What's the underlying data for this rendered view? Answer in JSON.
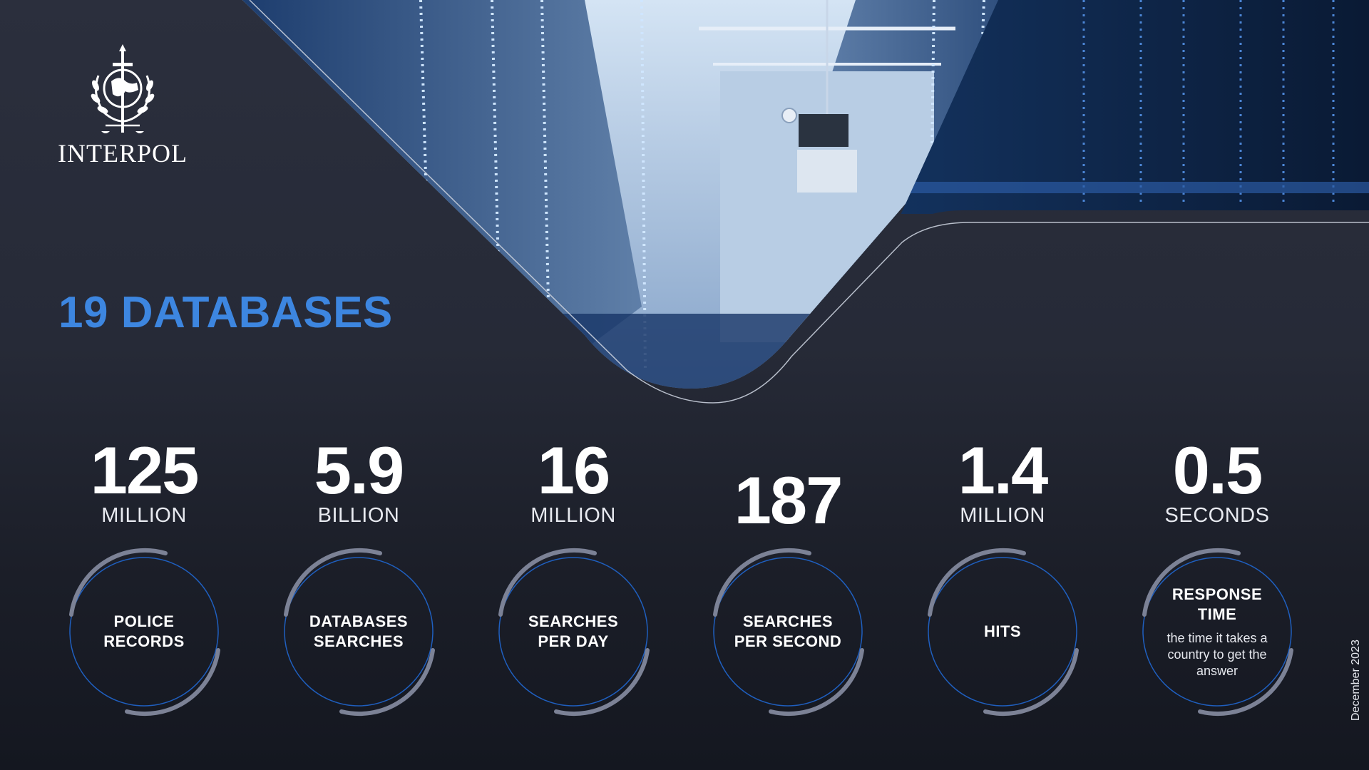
{
  "brand": {
    "name": "INTERPOL"
  },
  "title": "19 DATABASES",
  "stats": [
    {
      "number": "125",
      "unit": "MILLION",
      "label": "POLICE\nRECORDS",
      "desc": ""
    },
    {
      "number": "5.9",
      "unit": "BILLION",
      "label": "DATABASES\nSEARCHES",
      "desc": ""
    },
    {
      "number": "16",
      "unit": "MILLION",
      "label": "SEARCHES\nPER DAY",
      "desc": ""
    },
    {
      "number": "187",
      "unit": "",
      "label": "SEARCHES\nPER SECOND",
      "desc": ""
    },
    {
      "number": "1.4",
      "unit": "MILLION",
      "label": "HITS",
      "desc": ""
    },
    {
      "number": "0.5",
      "unit": "SECONDS",
      "label": "RESPONSE\nTIME",
      "desc": "the time it takes a country to get the answer"
    }
  ],
  "footer": {
    "date": "December 2023"
  },
  "colors": {
    "accent": "#3d86e0",
    "background": "#262a37",
    "ring": "#8a90a6"
  }
}
